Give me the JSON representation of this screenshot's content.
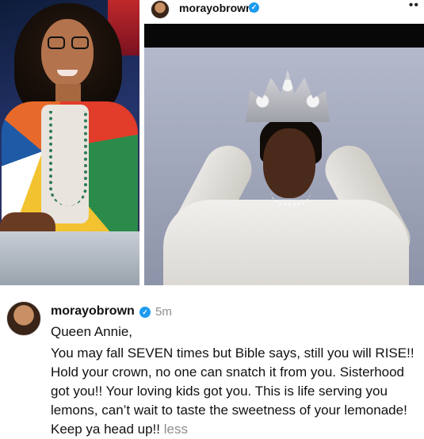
{
  "post": {
    "username": "morayobrown",
    "verified_icon": "verified-badge-icon",
    "more_icon": "•• "
  },
  "comment": {
    "username": "morayobrown",
    "time": "5m",
    "greeting": "Queen Annie,",
    "body": "You may fall SEVEN times but Bible says, still you will RISE!! Hold your crown, no one can snatch it from you. Sisterhood got you!! Your loving kids got you. This is life serving you lemons, can’t wait to taste the sweetness of your lemonade! Keep ya head up!!",
    "less_label": "less"
  },
  "colors": {
    "verified": "#1d9bf0",
    "muted_text": "#8e8e8e"
  }
}
